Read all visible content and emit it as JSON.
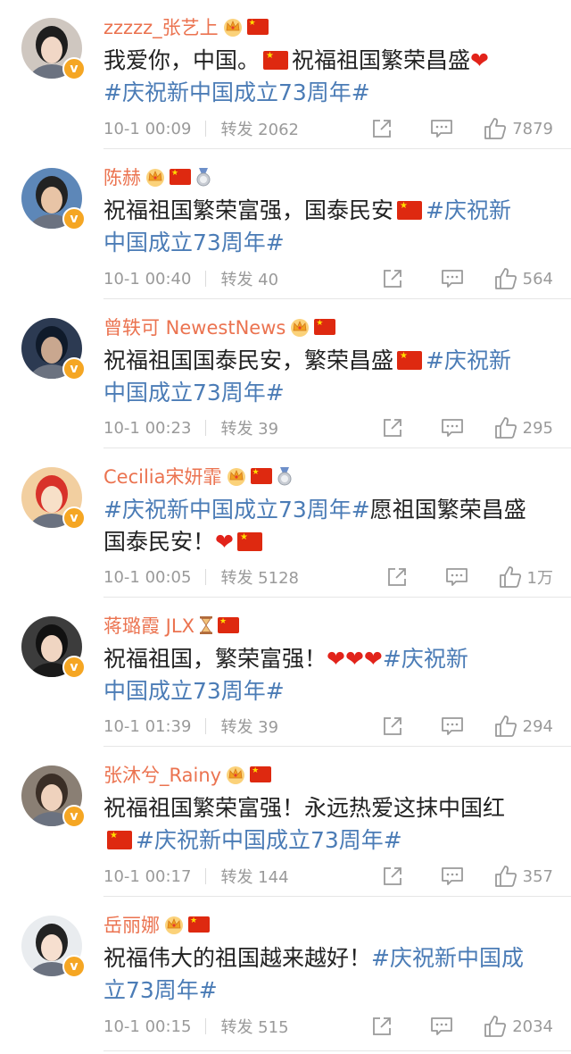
{
  "posts": [
    {
      "username": "zzzzz_张艺上",
      "badges": [
        "crown",
        "flag"
      ],
      "content": [
        {
          "t": "text",
          "v": "我爱你，中国。"
        },
        {
          "t": "flag"
        },
        {
          "t": "text",
          "v": "祝福祖国繁荣昌盛"
        },
        {
          "t": "heart",
          "v": "❤"
        },
        {
          "t": "br"
        },
        {
          "t": "tag",
          "v": "#庆祝新中国成立73周年#"
        }
      ],
      "time": "10-1 00:09",
      "repost_label": "转发 2062",
      "likes": "7879",
      "avatar_color": "#cfc7c0"
    },
    {
      "username": "陈赫",
      "badges": [
        "crown",
        "flag",
        "medal"
      ],
      "content": [
        {
          "t": "text",
          "v": "祝福祖国繁荣富强，国泰民安"
        },
        {
          "t": "flag"
        },
        {
          "t": "tag",
          "v": "#庆祝新"
        },
        {
          "t": "br"
        },
        {
          "t": "tag",
          "v": "中国成立73周年#"
        }
      ],
      "time": "10-1 00:40",
      "repost_label": "转发 40",
      "likes": "564",
      "avatar_color": "#5d87b8"
    },
    {
      "username": "曾轶可 NewestNews",
      "badges": [
        "crown",
        "flag"
      ],
      "content": [
        {
          "t": "text",
          "v": "祝福祖国国泰民安，繁荣昌盛"
        },
        {
          "t": "flag"
        },
        {
          "t": "tag",
          "v": "#庆祝新"
        },
        {
          "t": "br"
        },
        {
          "t": "tag",
          "v": "中国成立73周年#"
        }
      ],
      "time": "10-1 00:23",
      "repost_label": "转发 39",
      "likes": "295",
      "avatar_color": "#2c3a52"
    },
    {
      "username": "Cecilia宋妍霏",
      "badges": [
        "crown",
        "flag",
        "medal"
      ],
      "content": [
        {
          "t": "tag",
          "v": "#庆祝新中国成立73周年#"
        },
        {
          "t": "text",
          "v": "愿祖国繁荣昌盛"
        },
        {
          "t": "br"
        },
        {
          "t": "text",
          "v": "国泰民安！"
        },
        {
          "t": "heart",
          "v": "❤"
        },
        {
          "t": "flag"
        }
      ],
      "time": "10-1 00:05",
      "repost_label": "转发 5128",
      "likes": "1万",
      "avatar_color": "#f2cfa0"
    },
    {
      "username": "蒋璐霞 JLX",
      "badges": [
        "hourglass",
        "flag"
      ],
      "content": [
        {
          "t": "text",
          "v": "祝福祖国，繁荣富强！"
        },
        {
          "t": "heart",
          "v": "❤"
        },
        {
          "t": "heart",
          "v": "❤"
        },
        {
          "t": "heart",
          "v": "❤"
        },
        {
          "t": "tag",
          "v": "#庆祝新"
        },
        {
          "t": "br"
        },
        {
          "t": "tag",
          "v": "中国成立73周年#"
        }
      ],
      "time": "10-1 01:39",
      "repost_label": "转发 39",
      "likes": "294",
      "avatar_color": "#3c3c3c"
    },
    {
      "username": "张沐兮_Rainy",
      "badges": [
        "crown",
        "flag"
      ],
      "content": [
        {
          "t": "text",
          "v": "祝福祖国繁荣富强！永远热爱这抹中国红"
        },
        {
          "t": "br"
        },
        {
          "t": "flag"
        },
        {
          "t": "tag",
          "v": "#庆祝新中国成立73周年#"
        }
      ],
      "time": "10-1 00:17",
      "repost_label": "转发 144",
      "likes": "357",
      "avatar_color": "#8a7f74"
    },
    {
      "username": "岳丽娜",
      "badges": [
        "crown",
        "flag"
      ],
      "content": [
        {
          "t": "text",
          "v": "祝福伟大的祖国越来越好！"
        },
        {
          "t": "tag",
          "v": "#庆祝新中国成"
        },
        {
          "t": "br"
        },
        {
          "t": "tag",
          "v": "立73周年#"
        }
      ],
      "time": "10-1 00:15",
      "repost_label": "转发 515",
      "likes": "2034",
      "avatar_color": "#e9ecef"
    }
  ],
  "icons": {
    "share": "share-icon",
    "comment": "comment-icon",
    "like": "thumbs-up-icon",
    "verified": "verified-badge-icon",
    "crown": "crown-icon",
    "flag": "china-flag-icon",
    "medal": "medal-icon",
    "hourglass": "hourglass-icon"
  },
  "verified_mark": "v",
  "colors": {
    "username": "#eb7350",
    "hashtag": "#4b7cb6",
    "body_text": "#222222",
    "meta_text": "#9a9a9a",
    "heart": "#e2231a",
    "flag_red": "#de2910",
    "verified_badge": "#f5a623"
  }
}
